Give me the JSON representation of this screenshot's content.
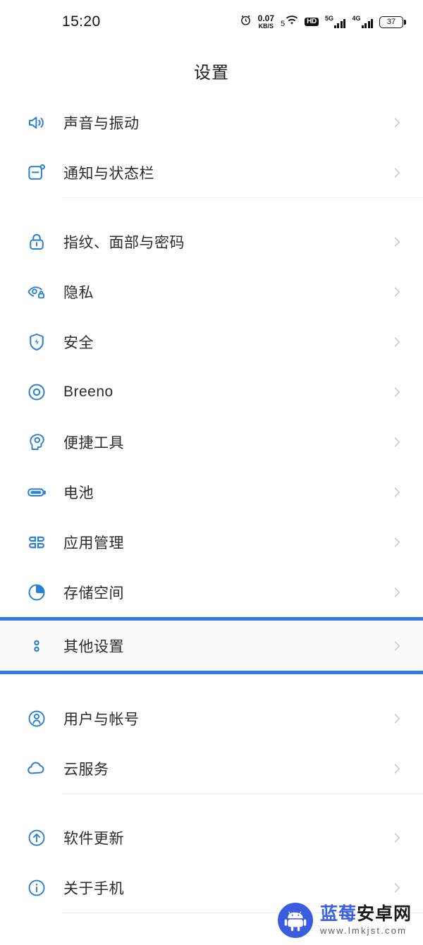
{
  "statusbar": {
    "time": "15:20",
    "alarm_icon": "alarm-clock-icon",
    "net_speed_value": "0.07",
    "net_speed_unit": "KB/S",
    "wifi_label": "5",
    "wifi_icon": "wifi-icon",
    "hd_badge": "HD",
    "sim1_label": "5G",
    "sim2_label": "4G",
    "battery_level": "37"
  },
  "header": {
    "title": "设置"
  },
  "groups": [
    {
      "items": [
        {
          "label": "声音与振动",
          "icon": "speaker-volume-icon"
        },
        {
          "label": "通知与状态栏",
          "icon": "notification-panel-icon"
        }
      ]
    },
    {
      "items": [
        {
          "label": "指纹、面部与密码",
          "icon": "lock-icon"
        },
        {
          "label": "隐私",
          "icon": "privacy-eye-icon"
        },
        {
          "label": "安全",
          "icon": "shield-bolt-icon"
        },
        {
          "label": "Breeno",
          "icon": "breeno-circle-icon"
        },
        {
          "label": "便捷工具",
          "icon": "convenience-head-icon"
        },
        {
          "label": "电池",
          "icon": "battery-icon"
        },
        {
          "label": "应用管理",
          "icon": "apps-grid-icon"
        },
        {
          "label": "存储空间",
          "icon": "storage-pie-icon"
        },
        {
          "label": "其他设置",
          "icon": "more-dots-icon",
          "highlighted": true
        }
      ]
    },
    {
      "items": [
        {
          "label": "用户与帐号",
          "icon": "user-account-icon"
        },
        {
          "label": "云服务",
          "icon": "cloud-icon"
        }
      ]
    },
    {
      "items": [
        {
          "label": "软件更新",
          "icon": "update-arrow-icon"
        },
        {
          "label": "关于手机",
          "icon": "info-icon"
        }
      ]
    }
  ],
  "watermark": {
    "brand_blue": "蓝莓",
    "brand_black": "安卓网",
    "url": "www.lmkjst.com",
    "logo_icon": "android-robot-icon"
  },
  "colors": {
    "accent_blue": "#357ae0",
    "icon_blue": "#2a7fd4",
    "text": "#2b2b2b",
    "divider": "#ececec"
  }
}
